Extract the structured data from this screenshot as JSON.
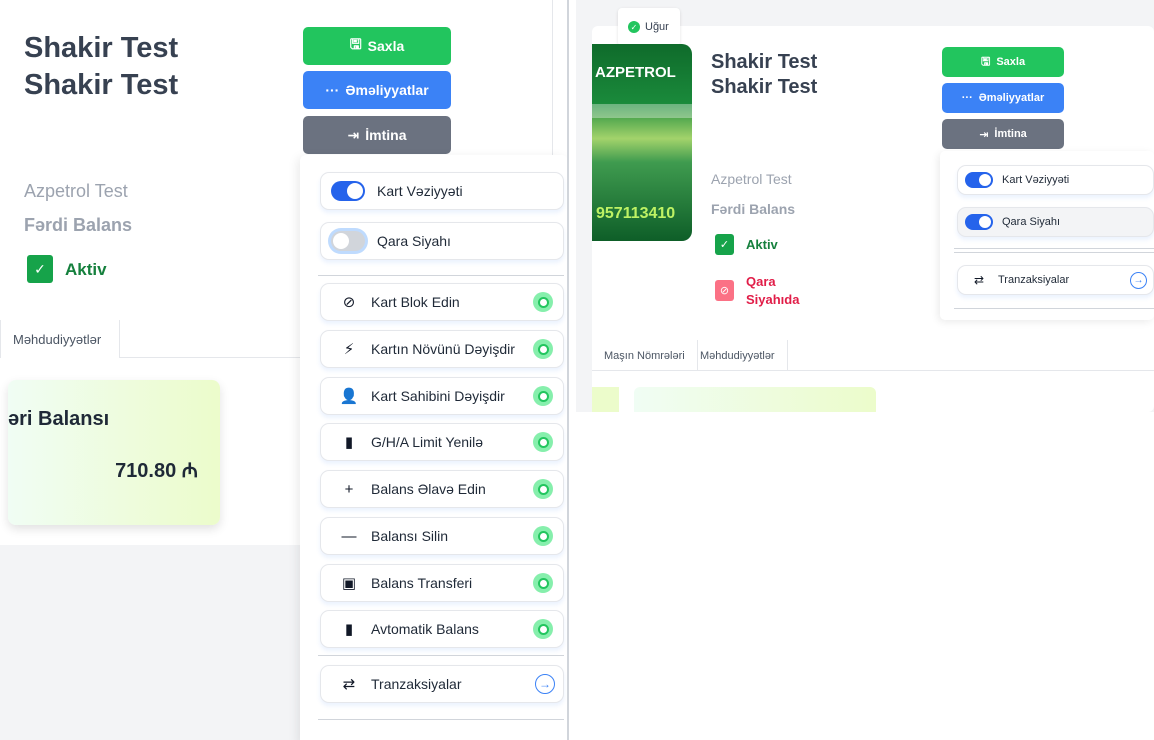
{
  "left": {
    "name": "Shakir Test Shakir Test",
    "company": "Azpetrol Test",
    "balance_type": "Fərdi Balans",
    "status": "Aktiv",
    "tab": "Məhdudiyyətlər",
    "card": {
      "title": "əri Balansı",
      "amount": "710.80 ₼"
    },
    "buttons": {
      "save": "Saxla",
      "actions": "Əməliyyatlar",
      "cancel": "İmtina"
    },
    "toggles": [
      {
        "label": "Kart Vəziyyəti",
        "on": true
      },
      {
        "label": "Qara Siyahı",
        "on": false
      }
    ],
    "actions": [
      {
        "label": "Kart Blok Edin",
        "icon": "ban-icon"
      },
      {
        "label": "Kartın Növünü Dəyişdir",
        "icon": "bolt-icon"
      },
      {
        "label": "Kart Sahibini Dəyişdir",
        "icon": "user-edit-icon"
      },
      {
        "label": "G/H/A Limit Yenilə",
        "icon": "bar-chart-icon"
      },
      {
        "label": "Balans Əlavə Edin",
        "icon": "plus-icon"
      },
      {
        "label": "Balansı Silin",
        "icon": "minus-icon"
      },
      {
        "label": "Balans Transferi",
        "icon": "money-bill-icon"
      },
      {
        "label": "Avtomatik Balans",
        "icon": "bar-chart-icon"
      }
    ],
    "transactions": "Tranzaksiyalar"
  },
  "right": {
    "toast": "Uğur",
    "card": {
      "brand": "AZPETROL",
      "number": "957113410"
    },
    "name": "Shakir Test Shakir Test",
    "company": "Azpetrol Test",
    "balance_type": "Fərdi Balans",
    "status": "Aktiv",
    "blacklist_status": "Qara Siyahıda",
    "tabs": [
      "Maşın Nömrələri",
      "Məhdudiyyətlər"
    ],
    "buttons": {
      "save": "Saxla",
      "actions": "Əməliyyatlar",
      "cancel": "İmtina"
    },
    "toggles": [
      {
        "label": "Kart Vəziyyəti",
        "on": true
      },
      {
        "label": "Qara Siyahı",
        "on": true
      }
    ],
    "transactions": "Tranzaksiyalar"
  },
  "colors": {
    "success": "#22c55e",
    "primary": "#3b82f6",
    "secondary": "#6b7280",
    "danger": "#e11d48"
  }
}
